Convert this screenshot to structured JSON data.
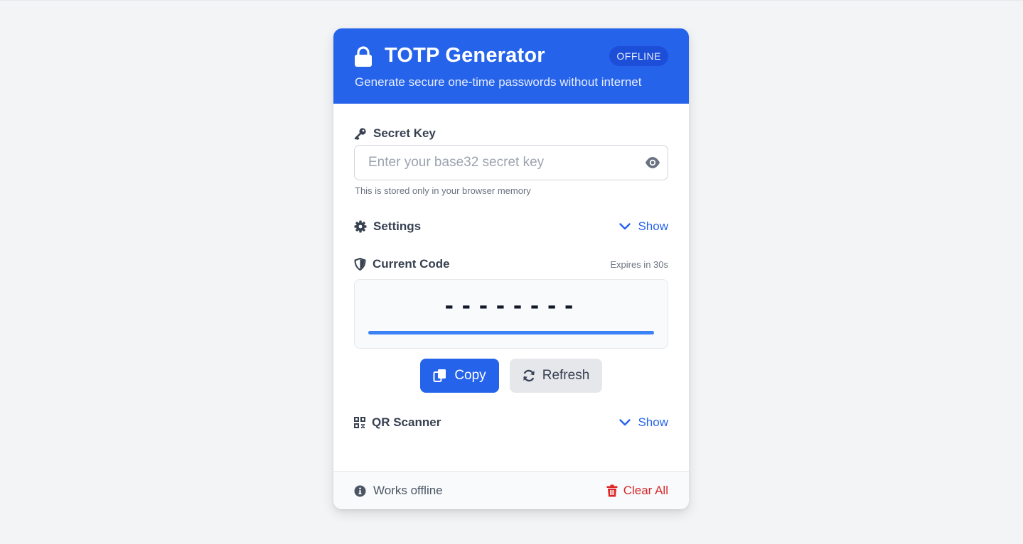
{
  "header": {
    "title": "TOTP Generator",
    "subtitle": "Generate secure one-time passwords without internet",
    "badge": "OFFLINE",
    "icon": "lock-icon"
  },
  "secret": {
    "label": "Secret Key",
    "icon": "key-icon",
    "value": "",
    "placeholder": "Enter your base32 secret key",
    "toggle_icon": "eye-icon",
    "hint": "This is stored only in your browser memory"
  },
  "settings": {
    "label": "Settings",
    "icon": "gear-icon",
    "toggle_label": "Show"
  },
  "current_code": {
    "label": "Current Code",
    "icon": "shield-icon",
    "expires": "Expires in 30s",
    "code": "--------",
    "progress_percent": 100
  },
  "actions": {
    "copy_label": "Copy",
    "refresh_label": "Refresh"
  },
  "qr": {
    "label": "QR Scanner",
    "icon": "qrcode-icon",
    "toggle_label": "Show"
  },
  "footer": {
    "status": "Works offline",
    "status_icon": "info-icon",
    "clear_label": "Clear All",
    "clear_icon": "trash-icon"
  },
  "colors": {
    "primary": "#2563eb",
    "background": "#f3f4f6",
    "danger": "#dc2626"
  }
}
